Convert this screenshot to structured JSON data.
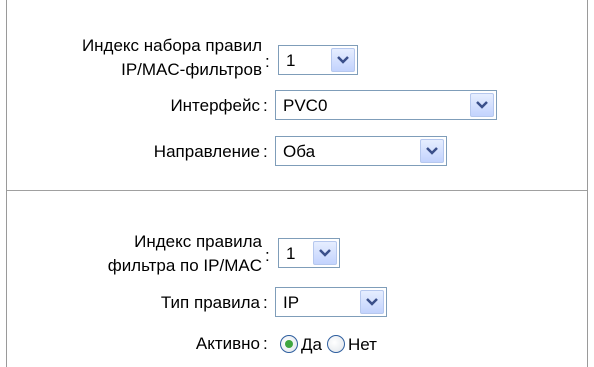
{
  "ruleset": {
    "index_label_line1": "Индекс набора правил",
    "index_label_line2": "IP/MAC-фильтров",
    "index_value": "1",
    "interface_label": "Интерфейс",
    "interface_value": "PVC0",
    "direction_label": "Направление",
    "direction_value": "Оба"
  },
  "rule": {
    "index_label_line1": "Индекс правила",
    "index_label_line2": "фильтра по IP/MAC",
    "index_value": "1",
    "type_label": "Тип правила",
    "type_value": "IP",
    "active_label": "Активно",
    "active_options": [
      "Да",
      "Нет"
    ],
    "active_selected": "Да"
  },
  "colon": ":",
  "colors": {
    "radio_selected": "#3fa63f",
    "select_border": "#7f9db9",
    "arrow_bg": "#c3d3fd"
  }
}
